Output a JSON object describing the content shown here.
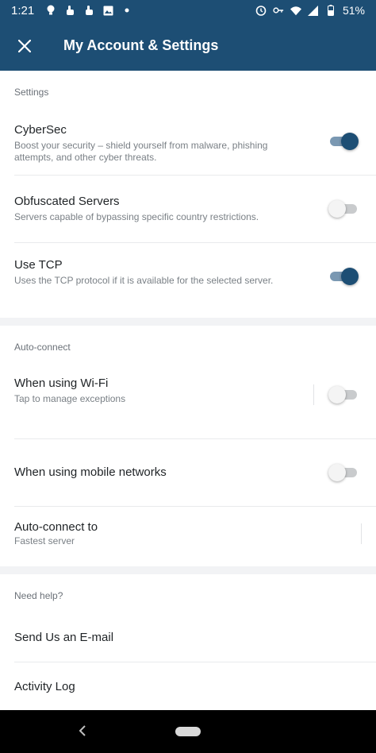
{
  "status_bar": {
    "time": "1:21",
    "battery": "51%",
    "icons_left": [
      "bulb-icon",
      "hand-icon",
      "hand-icon",
      "image-icon",
      "dot-icon"
    ],
    "icons_right": [
      "alarm-icon",
      "key-icon",
      "wifi-icon",
      "signal-icon",
      "battery-icon"
    ]
  },
  "app_bar": {
    "title": "My Account & Settings",
    "close_icon": "close-icon",
    "background": "#1d4e74"
  },
  "settings": {
    "header": "Settings",
    "items": [
      {
        "title": "CyberSec",
        "subtitle": "Boost your security – shield yourself from malware, phishing attempts, and other cyber threats.",
        "enabled": true
      },
      {
        "title": "Obfuscated Servers",
        "subtitle": "Servers capable of bypassing specific country restrictions.",
        "enabled": false
      },
      {
        "title": "Use TCP",
        "subtitle": "Uses the TCP protocol if it is available for the selected server.",
        "enabled": true
      }
    ]
  },
  "auto_connect": {
    "header": "Auto-connect",
    "wifi": {
      "title": "When using Wi-Fi",
      "subtitle": "Tap to manage exceptions",
      "enabled": false
    },
    "mobile": {
      "title": "When using mobile networks",
      "enabled": false
    },
    "connect_to": {
      "title": "Auto-connect to",
      "subtitle": "Fastest server"
    }
  },
  "help": {
    "header": "Need help?",
    "email": "Send Us an E-mail",
    "activity_log": "Activity Log"
  },
  "nav_bar": {
    "back_icon": "back-chevron-icon",
    "home_icon": "home-pill-icon"
  }
}
